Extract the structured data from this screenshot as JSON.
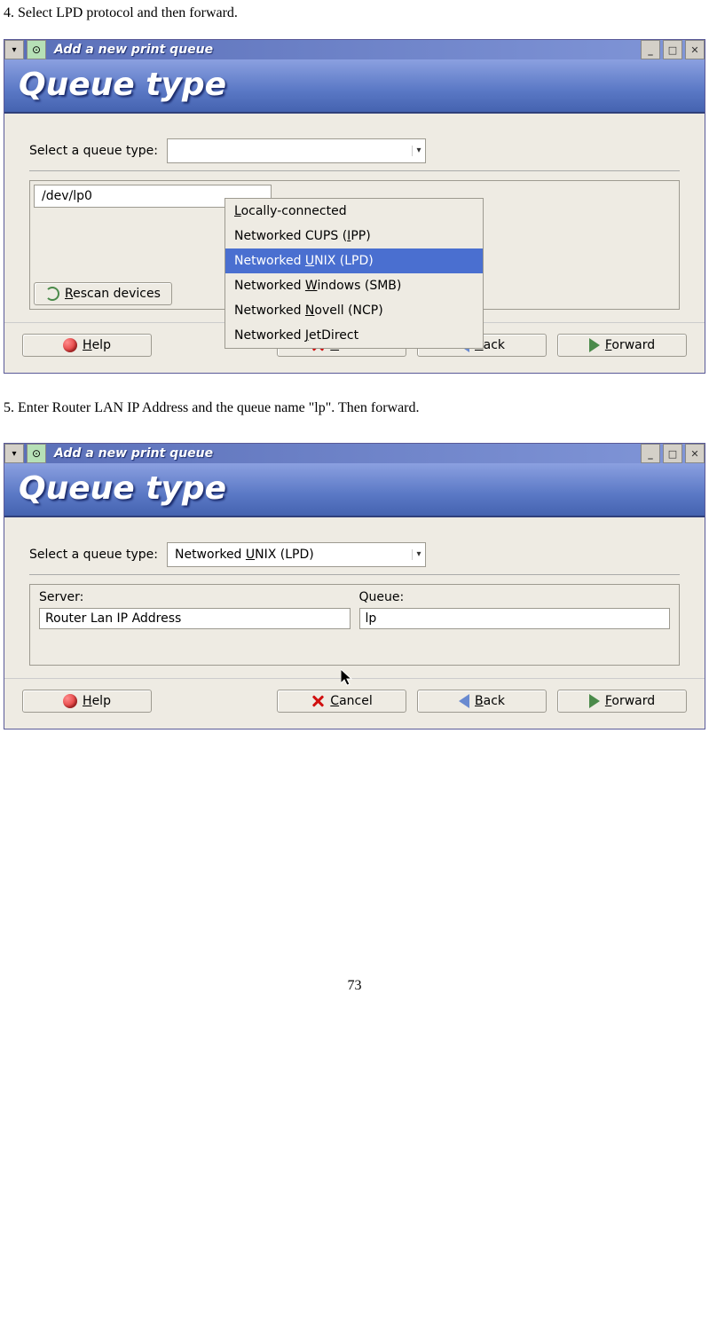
{
  "steps": {
    "step4": "4. Select LPD protocol and then forward.",
    "step5": "5. Enter Router LAN IP Address and the queue name \"lp\". Then forward."
  },
  "pageNumber": "73",
  "window1": {
    "title": "Add a new print queue",
    "bannerTitle": "Queue type",
    "selectLabel": "Select a queue type:",
    "comboShown": "",
    "listEntry": "/dev/lp0",
    "rescanLabel": {
      "pre": "",
      "u": "R",
      "post": "escan devices"
    },
    "dropdown": {
      "options": [
        {
          "pre": "",
          "u": "L",
          "post": "ocally-connected",
          "selected": false
        },
        {
          "pre": "Networked CUPS (",
          "u": "I",
          "post": "PP)",
          "selected": false
        },
        {
          "pre": "Networked ",
          "u": "U",
          "post": "NIX (LPD)",
          "selected": true
        },
        {
          "pre": "Networked ",
          "u": "W",
          "post": "indows (SMB)",
          "selected": false
        },
        {
          "pre": "Networked ",
          "u": "N",
          "post": "ovell (NCP)",
          "selected": false
        },
        {
          "pre": "Networked ",
          "u": "J",
          "post": "etDirect",
          "selected": false
        }
      ]
    },
    "buttons": {
      "help": {
        "u": "H",
        "post": "elp"
      },
      "cancel": {
        "u": "C",
        "post": "ancel"
      },
      "back": {
        "u": "B",
        "post": "ack"
      },
      "forward": {
        "u": "F",
        "post": "orward"
      }
    }
  },
  "window2": {
    "title": "Add a new print queue",
    "bannerTitle": "Queue type",
    "selectLabel": "Select a queue type:",
    "comboSelected": {
      "pre": "Networked ",
      "u": "U",
      "post": "NIX (LPD)"
    },
    "serverLabel": "Server:",
    "queueLabel": "Queue:",
    "serverValue": "Router Lan IP Address",
    "queueValue": "lp",
    "buttons": {
      "help": {
        "u": "H",
        "post": "elp"
      },
      "cancel": {
        "u": "C",
        "post": "ancel"
      },
      "back": {
        "u": "B",
        "post": "ack"
      },
      "forward": {
        "u": "F",
        "post": "orward"
      }
    }
  }
}
